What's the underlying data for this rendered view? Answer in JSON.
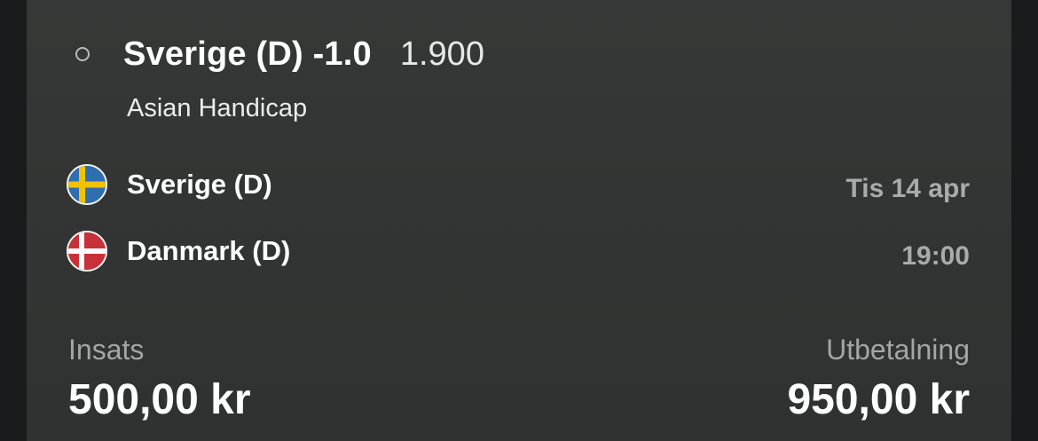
{
  "bet": {
    "selection": "Sverige (D) -1.0",
    "odds": "1.900",
    "market": "Asian Handicap"
  },
  "match": {
    "home_team": "Sverige (D)",
    "away_team": "Danmark (D)",
    "date": "Tis 14 apr",
    "time": "19:00",
    "home_flag_icon": "sweden-flag-icon",
    "away_flag_icon": "denmark-flag-icon"
  },
  "summary": {
    "stake_label": "Insats",
    "stake_value": "500,00 kr",
    "payout_label": "Utbetalning",
    "payout_value": "950,00 kr"
  },
  "colors": {
    "card_background": "#343635",
    "page_background": "#1a1b1c",
    "primary_text": "#ffffff",
    "secondary_text": "#a9abaa",
    "sweden_blue": "#2f6fb0",
    "sweden_yellow": "#f2c200",
    "denmark_red": "#c8303a"
  }
}
